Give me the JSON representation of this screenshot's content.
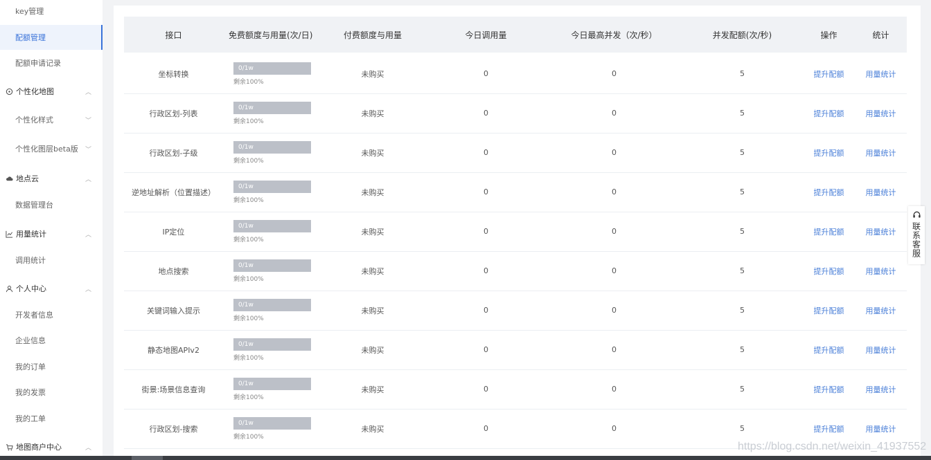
{
  "sidebar": {
    "items": [
      {
        "label": "key管理",
        "type": "sub"
      },
      {
        "label": "配额管理",
        "type": "sub",
        "active": true
      },
      {
        "label": "配额申请记录",
        "type": "sub"
      },
      {
        "label": "个性化地图",
        "type": "group",
        "icon": "palette-icon"
      },
      {
        "label": "个性化样式",
        "type": "sub",
        "chevron": "down"
      },
      {
        "label": "个性化图层beta版",
        "type": "sub",
        "chevron": "down"
      },
      {
        "label": "地点云",
        "type": "group",
        "icon": "cloud-icon"
      },
      {
        "label": "数据管理台",
        "type": "sub"
      },
      {
        "label": "用量统计",
        "type": "group",
        "icon": "line-chart-icon"
      },
      {
        "label": "调用统计",
        "type": "sub"
      },
      {
        "label": "个人中心",
        "type": "group",
        "icon": "user-icon"
      },
      {
        "label": "开发者信息",
        "type": "sub"
      },
      {
        "label": "企业信息",
        "type": "sub"
      },
      {
        "label": "我的订单",
        "type": "sub"
      },
      {
        "label": "我的发票",
        "type": "sub"
      },
      {
        "label": "我的工单",
        "type": "sub"
      },
      {
        "label": "地图商户中心",
        "type": "group",
        "icon": "cart-icon"
      }
    ]
  },
  "table": {
    "headers": [
      "接口",
      "免费额度与用量(次/日)",
      "付费额度与用量",
      "今日调用量",
      "今日最高并发（次/秒）",
      "并发配额(次/秒)",
      "操作",
      "统计"
    ],
    "rows": [
      {
        "name": "坐标转换",
        "quota": "0/1w",
        "remain": "剩余100%",
        "paid": "未购买",
        "today": "0",
        "peak": "0",
        "concurrency": "5",
        "action": "提升配额",
        "stats": "用量统计"
      },
      {
        "name": "行政区划-列表",
        "quota": "0/1w",
        "remain": "剩余100%",
        "paid": "未购买",
        "today": "0",
        "peak": "0",
        "concurrency": "5",
        "action": "提升配额",
        "stats": "用量统计"
      },
      {
        "name": "行政区划-子级",
        "quota": "0/1w",
        "remain": "剩余100%",
        "paid": "未购买",
        "today": "0",
        "peak": "0",
        "concurrency": "5",
        "action": "提升配额",
        "stats": "用量统计"
      },
      {
        "name": "逆地址解析（位置描述）",
        "quota": "0/1w",
        "remain": "剩余100%",
        "paid": "未购买",
        "today": "0",
        "peak": "0",
        "concurrency": "5",
        "action": "提升配额",
        "stats": "用量统计"
      },
      {
        "name": "IP定位",
        "quota": "0/1w",
        "remain": "剩余100%",
        "paid": "未购买",
        "today": "0",
        "peak": "0",
        "concurrency": "5",
        "action": "提升配额",
        "stats": "用量统计"
      },
      {
        "name": "地点搜索",
        "quota": "0/1w",
        "remain": "剩余100%",
        "paid": "未购买",
        "today": "0",
        "peak": "0",
        "concurrency": "5",
        "action": "提升配额",
        "stats": "用量统计"
      },
      {
        "name": "关键词输入提示",
        "quota": "0/1w",
        "remain": "剩余100%",
        "paid": "未购买",
        "today": "0",
        "peak": "0",
        "concurrency": "5",
        "action": "提升配额",
        "stats": "用量统计"
      },
      {
        "name": "静态地图APIv2",
        "quota": "0/1w",
        "remain": "剩余100%",
        "paid": "未购买",
        "today": "0",
        "peak": "0",
        "concurrency": "5",
        "action": "提升配额",
        "stats": "用量统计"
      },
      {
        "name": "街景:场景信息查询",
        "quota": "0/1w",
        "remain": "剩余100%",
        "paid": "未购买",
        "today": "0",
        "peak": "0",
        "concurrency": "5",
        "action": "提升配额",
        "stats": "用量统计"
      },
      {
        "name": "行政区划-搜索",
        "quota": "0/1w",
        "remain": "剩余100%",
        "paid": "未购买",
        "today": "0",
        "peak": "0",
        "concurrency": "5",
        "action": "提升配额",
        "stats": "用量统计"
      }
    ]
  },
  "service_tab": {
    "label": "联系客服",
    "icon": "headset-icon"
  },
  "watermark": "https://blog.csdn.net/weixin_41937552",
  "colors": {
    "accent": "#3a73d9",
    "link": "#4a7fd8",
    "bar": "#bcc0c8"
  }
}
